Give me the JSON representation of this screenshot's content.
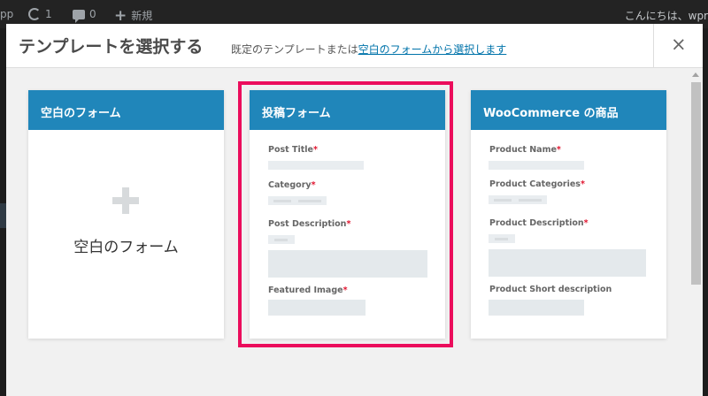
{
  "adminbar": {
    "site_fragment": "pp",
    "updates_count": "1",
    "comments_count": "0",
    "new_label": "新規",
    "greeting": "こんにちは、wpr"
  },
  "modal": {
    "title": "テンプレートを選択する",
    "subtitle_prefix": "既定のテンプレートまたは",
    "subtitle_link": "空白のフォームから選択します",
    "close_label": "×"
  },
  "cards": [
    {
      "title": "空白のフォーム",
      "blank_label": "空白のフォーム"
    },
    {
      "title": "投稿フォーム",
      "selected": true,
      "fields": [
        {
          "label": "Post Title",
          "required": "*"
        },
        {
          "label": "Category",
          "required": "*"
        },
        {
          "label": "Post Description",
          "required": "*"
        },
        {
          "label": "Featured Image",
          "required": "*"
        }
      ]
    },
    {
      "title": "WooCommerce の商品",
      "fields": [
        {
          "label": "Product Name",
          "required": "*"
        },
        {
          "label": "Product Categories",
          "required": "*"
        },
        {
          "label": "Product Description",
          "required": "*"
        },
        {
          "label": "Product Short description",
          "required": ""
        }
      ]
    }
  ],
  "colors": {
    "card_header": "#2086ba",
    "selection_border": "#eb0d5c",
    "required_mark": "#e0152f",
    "link": "#0073aa"
  }
}
